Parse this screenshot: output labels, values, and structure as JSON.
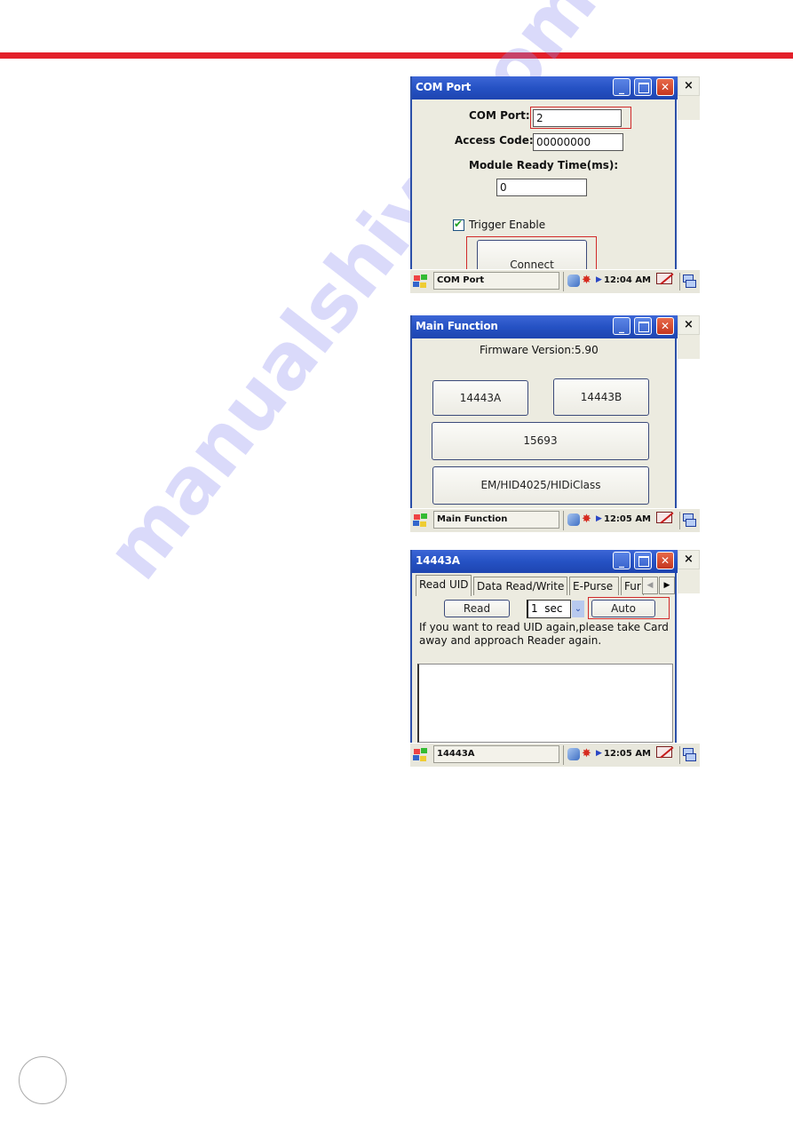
{
  "page": {
    "accent_color": "#e3202a",
    "watermark": "manualshive.com"
  },
  "screens": {
    "com_port": {
      "title": "COM Port",
      "com_port_label": "COM Port:",
      "com_port_value": "2",
      "access_code_label": "Access Code:",
      "access_code_value": "00000000",
      "module_ready_label": "Module Ready Time(ms):",
      "module_ready_value": "0",
      "trigger_enable_label": "Trigger Enable",
      "trigger_enable_checked": true,
      "connect_button": "Connect",
      "taskbar_task": "COM Port",
      "clock": "12:04 AM"
    },
    "main_function": {
      "title": "Main Function",
      "firmware_version": "Firmware Version:5.90",
      "buttons": [
        "14443A",
        "14443B",
        "15693",
        "EM/HID4025/HIDiClass"
      ],
      "taskbar_task": "Main Function",
      "clock": "12:05 AM"
    },
    "iso14443a": {
      "title": "14443A",
      "tabs": [
        "Read UID",
        "Data Read/Write",
        "E-Purse",
        "Fur"
      ],
      "active_tab": "Read UID",
      "read_button": "Read",
      "interval_value": "1  sec",
      "auto_button": "Auto",
      "instruction": "If you want to read UID again,please take Card",
      "instruction_line2": "away and approach Reader again.",
      "taskbar_task": "14443A",
      "clock": "12:05 AM"
    }
  },
  "common": {
    "close_x": "×",
    "minimize_glyph": "_",
    "maximize_glyph": "",
    "close_glyph": "✕",
    "tab_left": "◀",
    "tab_right": "▶",
    "dropdown_glyph": "⌄"
  }
}
